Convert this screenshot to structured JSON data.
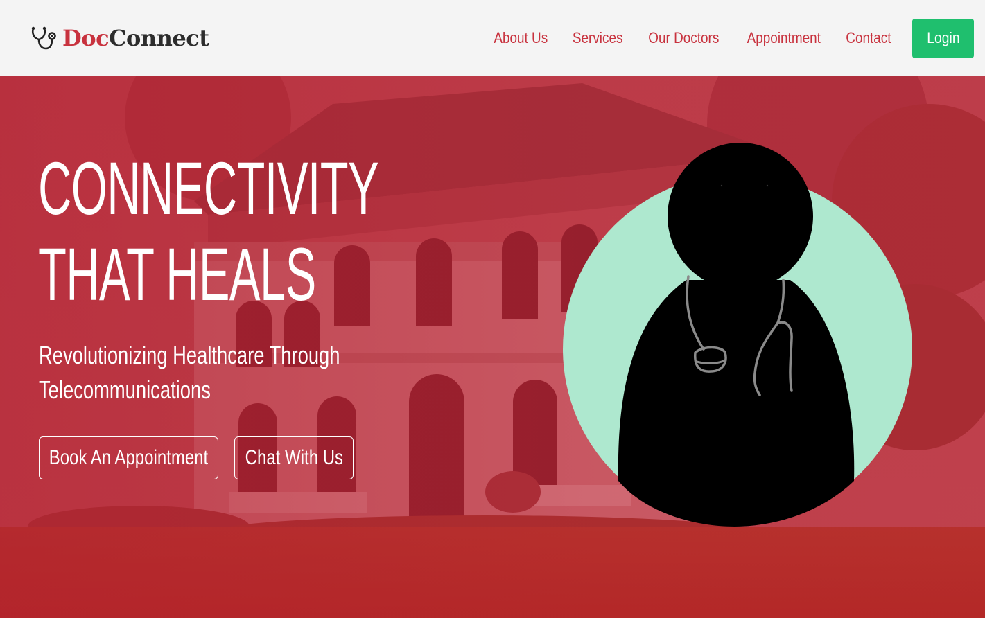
{
  "brand": {
    "name_part1": "Doc",
    "name_part2": "Connect",
    "icon": "stethoscope-icon"
  },
  "nav": {
    "links": [
      "About Us",
      "Services",
      "Our Doctors",
      "Appointment",
      "Contact"
    ],
    "login_label": "Login"
  },
  "hero": {
    "title_line1": "CONNECTIVITY",
    "title_line2": "THAT HEALS",
    "subtitle_line1": "Revolutionizing Healthcare Through",
    "subtitle_line2": "Telecommunications",
    "book_button": "Book An Appointment",
    "chat_button": "Chat With Us",
    "illustration": "doctor-avatar"
  },
  "colors": {
    "brand_red": "#c8323e",
    "hero_red": "#b32a36",
    "login_green": "#1fbf6e",
    "avatar_circle": "#aee8cf",
    "nav_bg": "#f4f4f4"
  }
}
